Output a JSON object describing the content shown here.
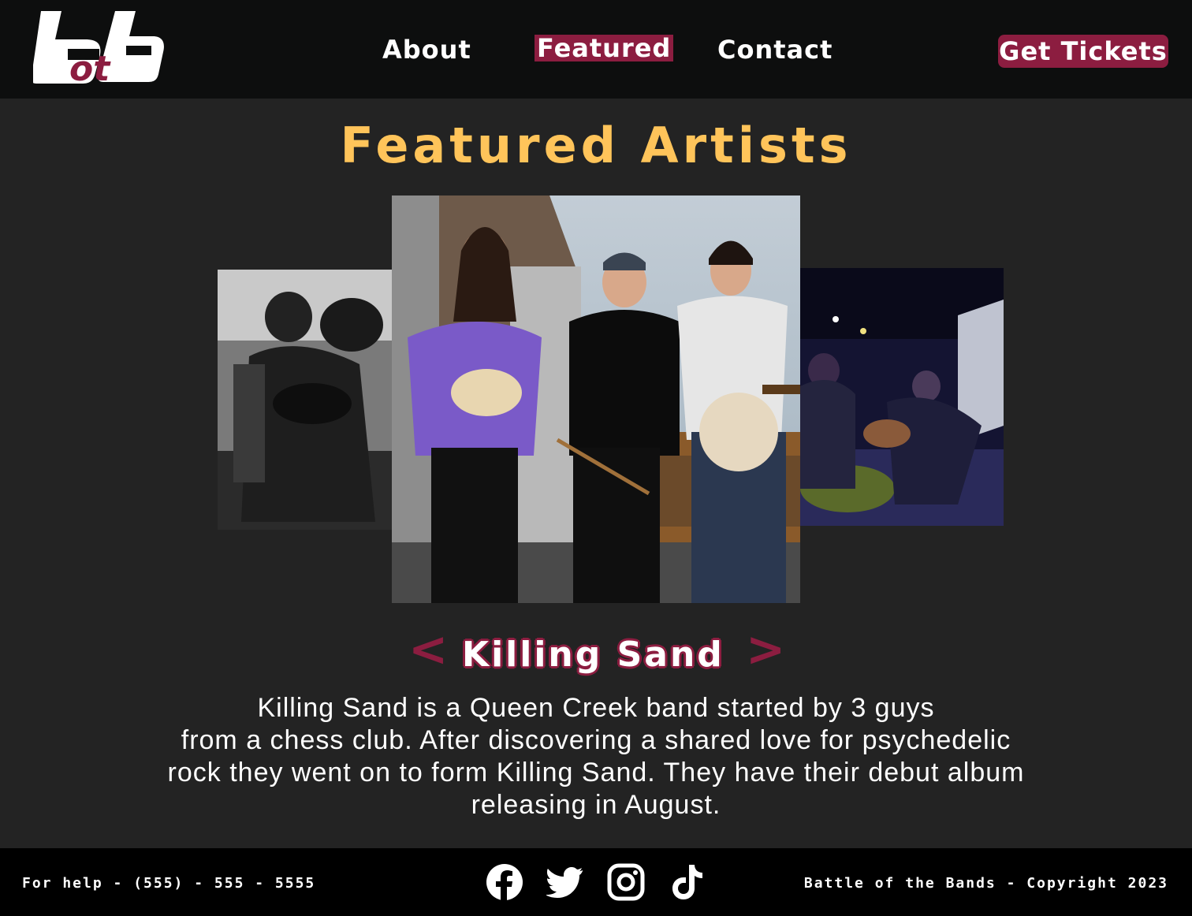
{
  "header": {
    "logo_text": "botb",
    "nav": [
      {
        "label": "About"
      },
      {
        "label": "Featured"
      },
      {
        "label": "Contact"
      }
    ],
    "cta_label": "Get Tickets"
  },
  "main": {
    "title": "Featured Artists",
    "carousel": {
      "prev_label": "<",
      "next_label": ">",
      "artist_name": "Killing Sand",
      "bio_lines": [
        "Killing Sand is a Queen Creek band started by 3 guys",
        "from a chess club. After discovering a shared love for psychedelic",
        "rock they went on to form Killing Sand. They have their debut album",
        "releasing in August."
      ]
    }
  },
  "footer": {
    "help": "For help - (555) - 555 - 5555",
    "copyright": "Battle of the Bands - Copyright 2023",
    "social": [
      "facebook-icon",
      "twitter-icon",
      "instagram-icon",
      "tiktok-icon"
    ]
  },
  "colors": {
    "accent": "#8c1d40",
    "title": "#ffc45a",
    "header_bg": "#0d0e0e",
    "page_bg": "#232323",
    "footer_bg": "#000000"
  }
}
